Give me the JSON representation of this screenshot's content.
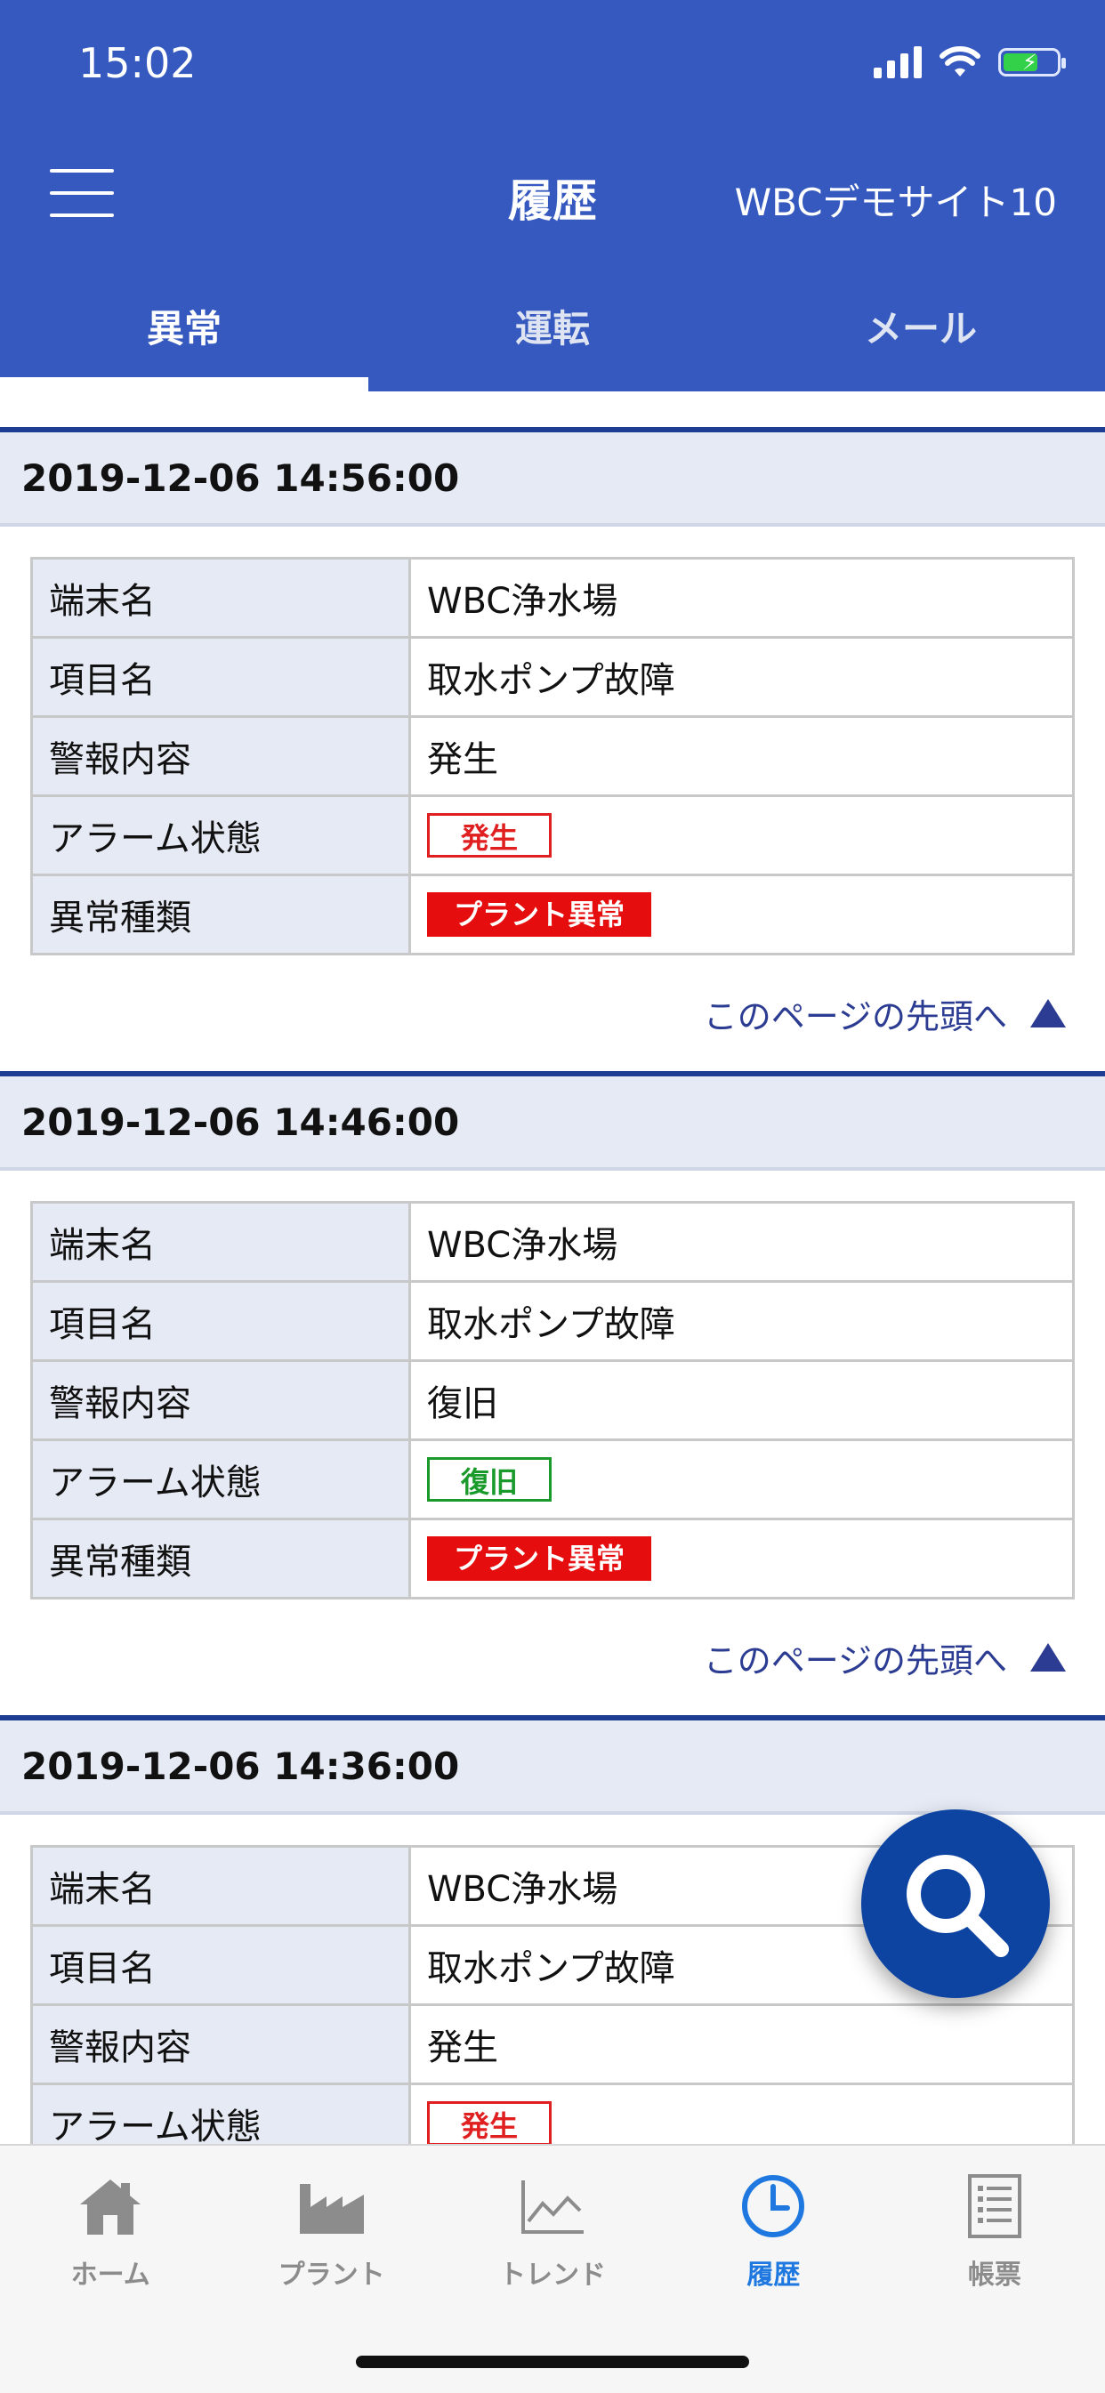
{
  "status_bar": {
    "time": "15:02"
  },
  "header": {
    "title": "履歴",
    "site": "WBCデモサイト10"
  },
  "tabs": [
    {
      "label": "異常",
      "active": true
    },
    {
      "label": "運転",
      "active": false
    },
    {
      "label": "メール",
      "active": false
    }
  ],
  "records": [
    {
      "datetime": "2019-12-06 14:56:00",
      "rows": [
        {
          "label": "端末名",
          "value": "WBC浄水場"
        },
        {
          "label": "項目名",
          "value": "取水ポンプ故障"
        },
        {
          "label": "警報内容",
          "value": "発生"
        },
        {
          "label": "アラーム状態",
          "value": "発生"
        },
        {
          "label": "異常種類",
          "value": "プラント異常"
        }
      ]
    },
    {
      "datetime": "2019-12-06 14:46:00",
      "rows": [
        {
          "label": "端末名",
          "value": "WBC浄水場"
        },
        {
          "label": "項目名",
          "value": "取水ポンプ故障"
        },
        {
          "label": "警報内容",
          "value": "復旧"
        },
        {
          "label": "アラーム状態",
          "value": "復旧"
        },
        {
          "label": "異常種類",
          "value": "プラント異常"
        }
      ]
    },
    {
      "datetime": "2019-12-06 14:36:00",
      "rows": [
        {
          "label": "端末名",
          "value": "WBC浄水場"
        },
        {
          "label": "項目名",
          "value": "取水ポンプ故障"
        },
        {
          "label": "警報内容",
          "value": "発生"
        },
        {
          "label": "アラーム状態",
          "value": "発生"
        }
      ]
    }
  ],
  "top_link": "このページの先頭へ",
  "bottom_nav": [
    {
      "label": "ホーム",
      "icon": "home-icon",
      "active": false
    },
    {
      "label": "プラント",
      "icon": "factory-icon",
      "active": false
    },
    {
      "label": "トレンド",
      "icon": "trend-chart-icon",
      "active": false
    },
    {
      "label": "履歴",
      "icon": "clock-icon",
      "active": true
    },
    {
      "label": "帳票",
      "icon": "report-icon",
      "active": false
    }
  ],
  "colors": {
    "header_blue": "#3559bf",
    "fab_blue": "#0d44a2",
    "alarm_red": "#e02020",
    "restore_green": "#1a9a2a",
    "nav_active": "#1e78e0"
  }
}
